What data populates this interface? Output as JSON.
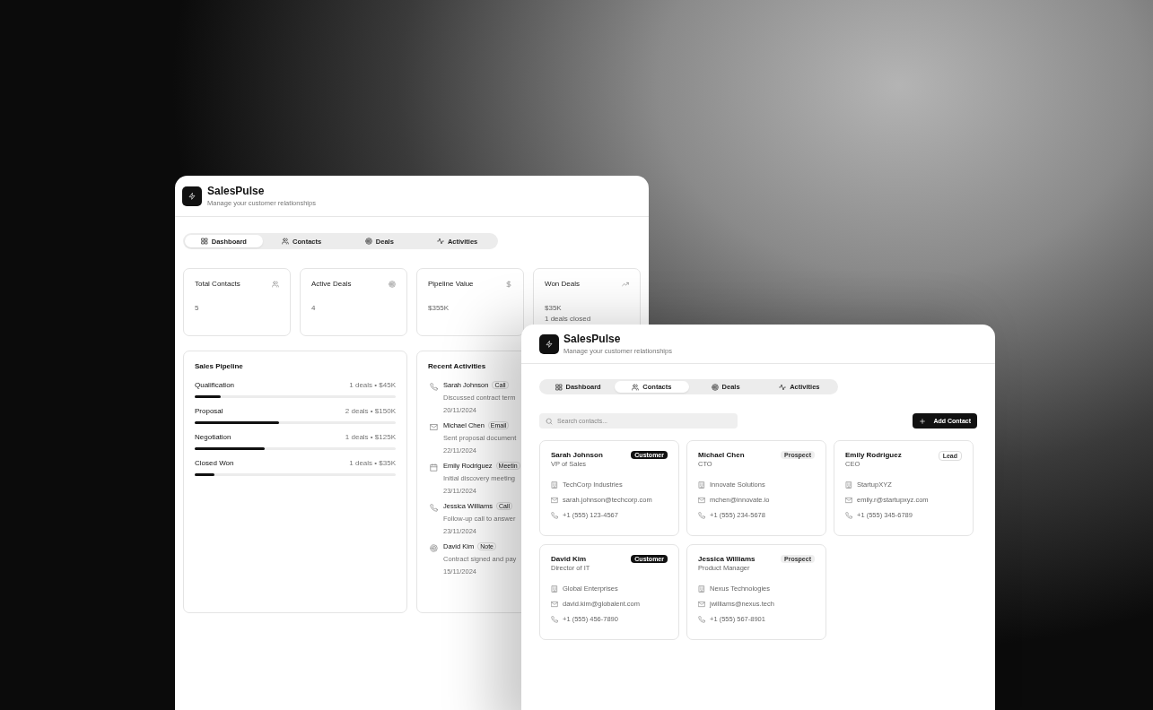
{
  "back_window": {
    "app": {
      "title": "SalesPulse",
      "subtitle": "Manage your customer relationships"
    },
    "tabs": [
      {
        "label": "Dashboard",
        "selected": true
      },
      {
        "label": "Contacts",
        "selected": false
      },
      {
        "label": "Deals",
        "selected": false
      },
      {
        "label": "Activities",
        "selected": false
      }
    ],
    "stats": [
      {
        "label": "Total Contacts",
        "value": "5"
      },
      {
        "label": "Active Deals",
        "value": "4"
      },
      {
        "label": "Pipeline Value",
        "value": "$355K"
      },
      {
        "label": "Won Deals",
        "value": "$35K",
        "note": "1 deals closed"
      }
    ],
    "pipeline": {
      "title": "Sales Pipeline",
      "stages": [
        {
          "name": "Qualification",
          "summary": "1 deals • $45K",
          "level": 0.13
        },
        {
          "name": "Proposal",
          "summary": "2 deals • $150K",
          "level": 0.42
        },
        {
          "name": "Negotiation",
          "summary": "1 deals • $125K",
          "level": 0.35
        },
        {
          "name": "Closed Won",
          "summary": "1 deals • $35K",
          "level": 0.1
        }
      ]
    },
    "activities": {
      "title": "Recent Activities",
      "items": [
        {
          "kind": "call",
          "name": "Sarah Johnson",
          "badge": "Call",
          "text": "Discussed contract term",
          "date": "20/11/2024"
        },
        {
          "kind": "email",
          "name": "Michael Chen",
          "badge": "Email",
          "text": "Sent proposal document",
          "date": "22/11/2024"
        },
        {
          "kind": "meeting",
          "name": "Emily Rodriguez",
          "badge": "Meetin",
          "text": "Initial discovery meeting",
          "date": "23/11/2024"
        },
        {
          "kind": "call",
          "name": "Jessica Williams",
          "badge": "Call",
          "text": "Follow-up call to answer",
          "date": "23/11/2024"
        },
        {
          "kind": "note",
          "name": "David Kim",
          "badge": "Note",
          "text": "Contract signed and pay",
          "date": "15/11/2024"
        }
      ]
    }
  },
  "front_window": {
    "app": {
      "title": "SalesPulse",
      "subtitle": "Manage your customer relationships"
    },
    "tabs": [
      {
        "label": "Dashboard",
        "selected": false
      },
      {
        "label": "Contacts",
        "selected": true
      },
      {
        "label": "Deals",
        "selected": false
      },
      {
        "label": "Activities",
        "selected": false
      }
    ],
    "search": {
      "placeholder": "Search contacts..."
    },
    "add_button": "Add Contact",
    "contacts": [
      {
        "name": "Sarah Johnson",
        "role": "VP of Sales",
        "badge": "Customer",
        "kind": "customer",
        "company": "TechCorp Industries",
        "email": "sarah.johnson@techcorp.com",
        "phone": "+1 (555) 123-4567"
      },
      {
        "name": "Michael Chen",
        "role": "CTO",
        "badge": "Prospect",
        "kind": "prospect",
        "company": "Innovate Solutions",
        "email": "mchen@innovate.io",
        "phone": "+1 (555) 234-5678"
      },
      {
        "name": "Emily Rodriguez",
        "role": "CEO",
        "badge": "Lead",
        "kind": "lead",
        "company": "StartupXYZ",
        "email": "emily.r@startupxyz.com",
        "phone": "+1 (555) 345-6789"
      },
      {
        "name": "David Kim",
        "role": "Director of IT",
        "badge": "Customer",
        "kind": "customer",
        "company": "Global Enterprises",
        "email": "david.kim@globalent.com",
        "phone": "+1 (555) 456-7890"
      },
      {
        "name": "Jessica Williams",
        "role": "Product Manager",
        "badge": "Prospect",
        "kind": "prospect",
        "company": "Nexus Technologies",
        "email": "jwilliams@nexus.tech",
        "phone": "+1 (555) 567-8901"
      }
    ]
  }
}
